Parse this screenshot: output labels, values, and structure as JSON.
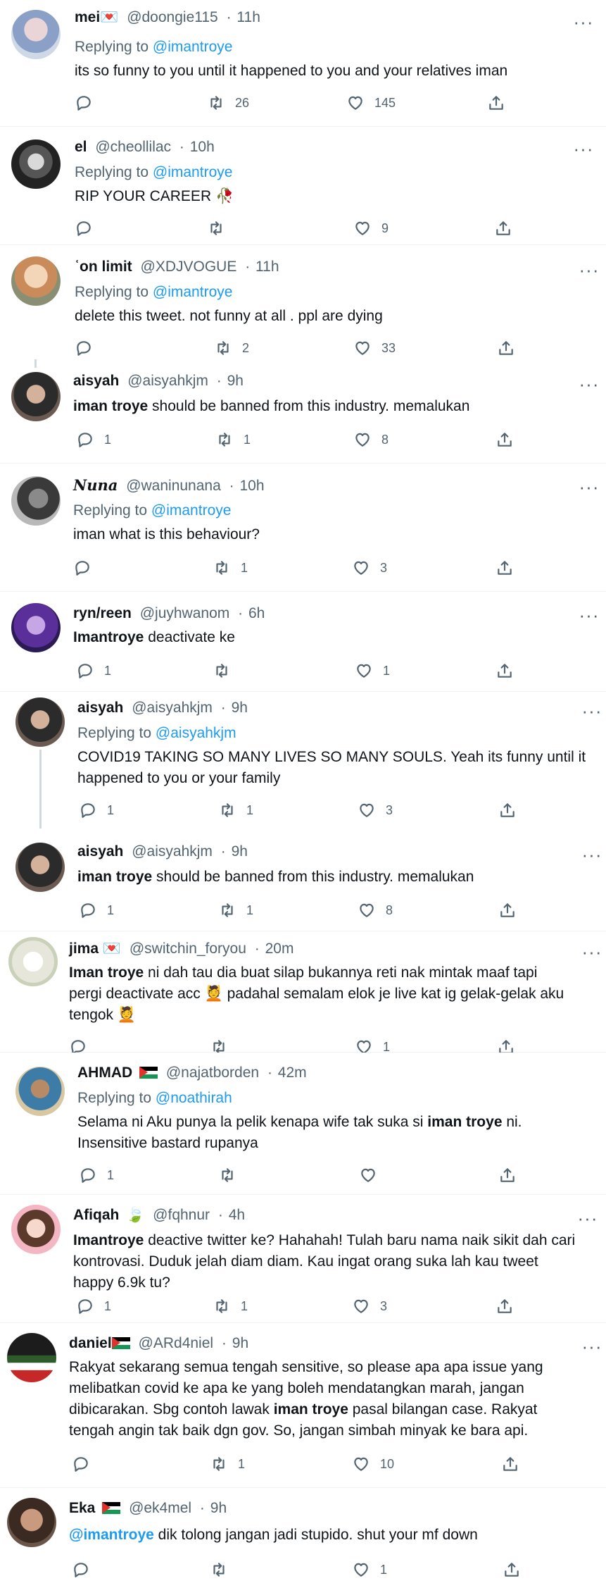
{
  "tweets": [
    {
      "name": "mei💌",
      "handle": "@doongie115",
      "time": "11h",
      "replying_to": "Replying to",
      "reply_handle": "@imantroye",
      "body": "its so funny to you until it happened to you and your relatives iman",
      "replies": "",
      "retweets": "26",
      "likes": "145"
    },
    {
      "name": "el",
      "handle": "@cheollilac",
      "time": "10h",
      "replying_to": "Replying to",
      "reply_handle": "@imantroye",
      "body": "RIP YOUR CAREER 🥀",
      "replies": "",
      "retweets": "",
      "likes": "9"
    },
    {
      "name": "ʿon limit",
      "handle": "@XDJVOGUE",
      "time": "11h",
      "replying_to": "Replying to",
      "reply_handle": "@imantroye",
      "body": "delete this tweet. not funny at all . ppl are dying",
      "replies": "",
      "retweets": "2",
      "likes": "33"
    },
    {
      "name": "aisyah",
      "handle": "@aisyahkjm",
      "time": "9h",
      "body_bold": "iman troye",
      "body": " should be banned from this industry. memalukan",
      "replies": "1",
      "retweets": "1",
      "likes": "8"
    },
    {
      "name": "𝑵𝒖𝒏𝒂",
      "handle": "@waninunana",
      "time": "10h",
      "replying_to": "Replying to",
      "reply_handle": "@imantroye",
      "body": "iman what is this behaviour?",
      "replies": "",
      "retweets": "1",
      "likes": "3"
    },
    {
      "name": "ryn/reen",
      "handle": "@juyhwanom",
      "time": "6h",
      "body_bold": "Imantroye",
      "body": " deactivate ke",
      "replies": "1",
      "retweets": "",
      "likes": "1"
    },
    {
      "name": "aisyah",
      "handle": "@aisyahkjm",
      "time": "9h",
      "replying_to": "Replying to",
      "reply_handle": "@aisyahkjm",
      "body_line1": "COVID19 TAKING SO MANY LIVES SO MANY SOULS. Yeah its funny until it",
      "body_line2": "happened to you or your family",
      "replies": "1",
      "retweets": "1",
      "likes": "3"
    },
    {
      "name": "aisyah",
      "handle": "@aisyahkjm",
      "time": "9h",
      "body_bold": "iman troye",
      "body": " should be banned from this industry. memalukan",
      "replies": "1",
      "retweets": "1",
      "likes": "8"
    },
    {
      "name": "jima 💌",
      "handle": "@switchin_foryou",
      "time": "20m",
      "body_bold": "Iman troye",
      "body_line1": " ni dah tau dia buat silap bukannya reti nak mintak maaf tapi",
      "body_line2": "pergi deactivate acc 💆 padahal semalam elok je live kat ig gelak-gelak aku",
      "body_line3": "tengok 💆",
      "replies": "",
      "retweets": "",
      "likes": "1"
    },
    {
      "name": "AHMAD",
      "handle": "@najatborden",
      "time": "42m",
      "replying_to": "Replying to",
      "reply_handle": "@noathirah",
      "body_line1a": "Selama ni Aku punya la pelik kenapa wife tak suka si ",
      "body_bold": "iman troye",
      "body_line1b": " ni.",
      "body_line2": "Insensitive bastard rupanya",
      "replies": "1",
      "retweets": "",
      "likes": ""
    },
    {
      "name": "Afiqah",
      "handle": "@fqhnur",
      "time": "4h",
      "body_bold": "Imantroye",
      "body_line1": " deactive twitter ke? Hahahah! Tulah baru nama naik sikit dah cari",
      "body_line2": "kontrovasi. Duduk jelah diam diam. Kau ingat orang suka lah kau tweet",
      "body_line3": "happy 6.9k tu?",
      "replies": "1",
      "retweets": "1",
      "likes": "3"
    },
    {
      "name": "daniel",
      "handle": "@ARd4niel",
      "time": "9h",
      "body_line1": "Rakyat sekarang semua tengah sensitive, so please apa apa issue yang",
      "body_line2": "melibatkan covid ke apa ke yang boleh mendatangkan marah, jangan",
      "body_line3a": "dibicarakan. Sbg contoh lawak ",
      "body_bold": "iman troye",
      "body_line3b": " pasal bilangan case. Rakyat",
      "body_line4": "tengah angin tak baik dgn gov. So, jangan simbah minyak ke bara api.",
      "replies": "",
      "retweets": "1",
      "likes": "10"
    },
    {
      "name": "Eka",
      "handle": "@ek4mel",
      "time": "9h",
      "mention": "@imantroye",
      "body": " dik tolong jangan jadi stupido. shut your mf down",
      "replies": "",
      "retweets": "",
      "likes": "1"
    }
  ],
  "separator": "·"
}
